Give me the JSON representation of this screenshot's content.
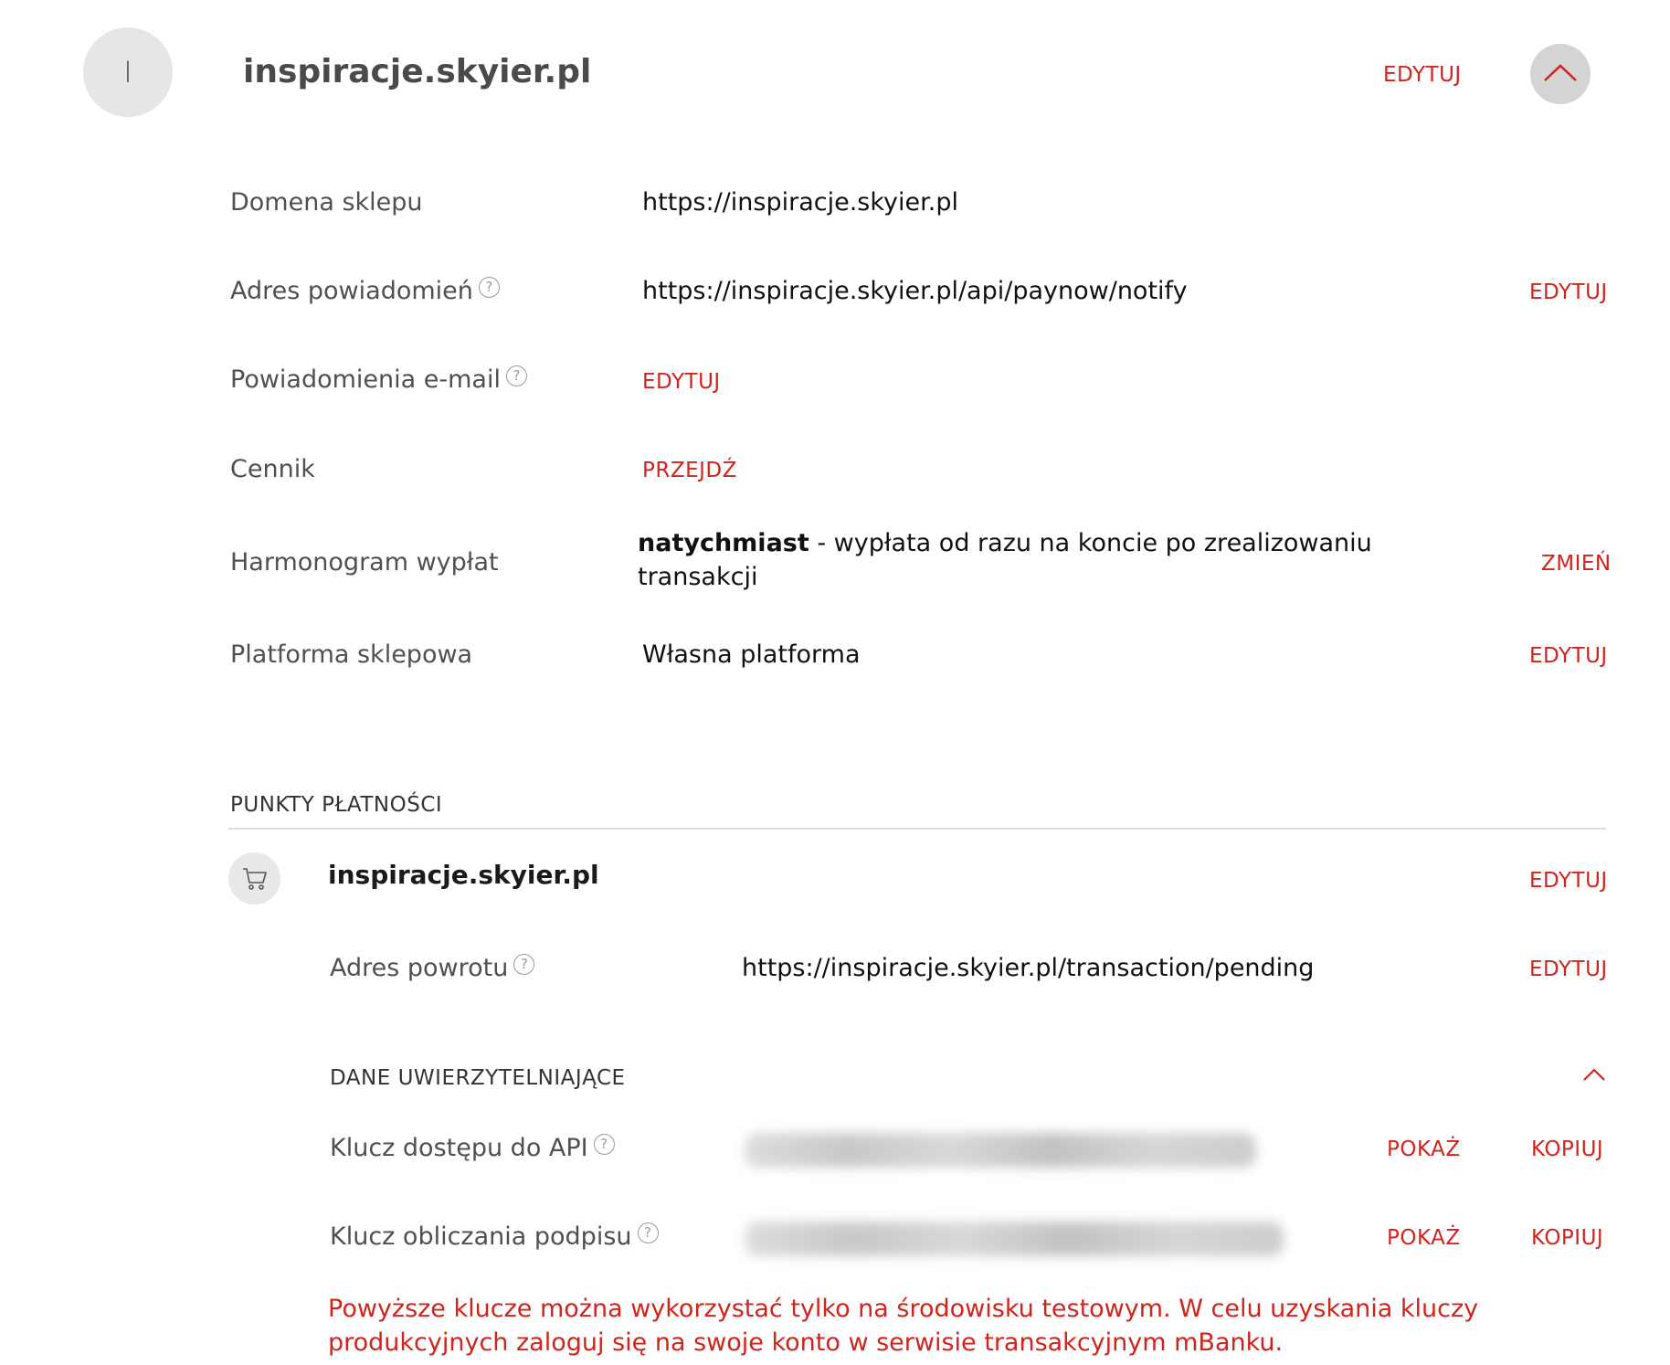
{
  "header": {
    "avatar_letter": "I",
    "shop_name": "inspiracje.skyier.pl",
    "edit_label": "EDYTUJ"
  },
  "details": {
    "domain": {
      "label": "Domena sklepu",
      "value": "https://inspiracje.skyier.pl"
    },
    "notify_address": {
      "label": "Adres powiadomień",
      "value": "https://inspiracje.skyier.pl/api/paynow/notify",
      "action": "EDYTUJ"
    },
    "email_notifications": {
      "label": "Powiadomienia e-mail",
      "action": "EDYTUJ"
    },
    "pricing": {
      "label": "Cennik",
      "action": "PRZEJDŹ"
    },
    "payout_schedule": {
      "label": "Harmonogram wypłat",
      "value_bold": "natychmiast",
      "value_rest": " - wypłata od razu na koncie po zrealizowaniu transakcji",
      "action": "ZMIEŃ"
    },
    "platform": {
      "label": "Platforma sklepowa",
      "value": "Własna platforma",
      "action": "EDYTUJ"
    }
  },
  "payment_points": {
    "section_title": "PUNKTY PŁATNOŚCI",
    "point": {
      "name": "inspiracje.skyier.pl",
      "edit_label": "EDYTUJ",
      "return_address": {
        "label": "Adres powrotu",
        "value": "https://inspiracje.skyier.pl/transaction/pending",
        "action": "EDYTUJ"
      },
      "credentials": {
        "title": "DANE UWIERZYTELNIAJĄCE",
        "api_key": {
          "label": "Klucz dostępu do API",
          "show": "POKAŻ",
          "copy": "KOPIUJ"
        },
        "signature_key": {
          "label": "Klucz obliczania podpisu",
          "show": "POKAŻ",
          "copy": "KOPIUJ"
        },
        "note": "Powyższe klucze można wykorzystać tylko na środowisku testowym. W celu uzyskania kluczy produkcyjnych zaloguj się na swoje konto w serwisie transakcyjnym mBanku."
      }
    }
  },
  "icons": {
    "help": "question-circle-icon",
    "cart": "cart-icon",
    "collapse": "chevron-up-icon",
    "accent_color": "#d0241c"
  }
}
